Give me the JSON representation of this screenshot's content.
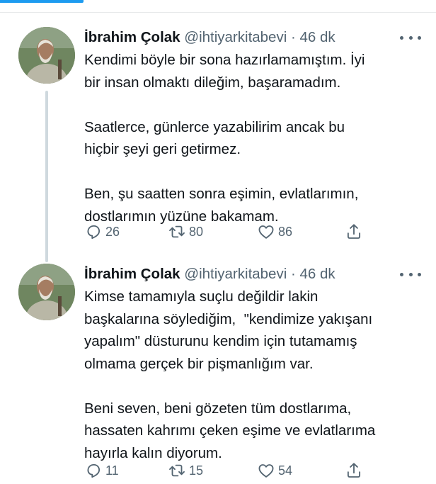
{
  "colors": {
    "accent": "#1d9bf0",
    "secondary_text": "#536471",
    "primary_text": "#0f1419",
    "thread_line": "#cfd9de"
  },
  "tweets": [
    {
      "author_name": "İbrahim Çolak",
      "handle": "@ihtiyarkitabevi",
      "separator": "·",
      "timestamp": "46 dk",
      "paragraphs": [
        "Kendimi böyle bir sona hazırlamamıştım. İyi\nbir insan olmaktı dileğim, başaramadım.",
        "Saatlerce, günlerce yazabilirim ancak bu\nhiçbir şeyi geri getirmez.",
        "Ben, şu saatten sonra eşimin, evlatlarımın,\ndostlarımın yüzüne bakamam."
      ],
      "replies": "26",
      "retweets": "80",
      "likes": "86"
    },
    {
      "author_name": "İbrahim Çolak",
      "handle": "@ihtiyarkitabevi",
      "separator": "·",
      "timestamp": "46 dk",
      "paragraphs": [
        "Kimse tamamıyla suçlu değildir lakin\nbaşkalarına söylediğim,  \"kendimize yakışanı\nyapalım\" düsturunu kendim için tutamamış\nolmama gerçek bir pişmanlığım var.",
        "Beni seven, beni gözeten tüm dostlarıma,\nhassaten kahrımı çeken eşime ve evlatlarıma\nhayırla kalın diyorum."
      ],
      "replies": "11",
      "retweets": "15",
      "likes": "54"
    }
  ],
  "icons": {
    "reply": "reply-icon",
    "retweet": "retweet-icon",
    "like": "heart-icon",
    "share": "share-icon",
    "more": "more-icon"
  }
}
